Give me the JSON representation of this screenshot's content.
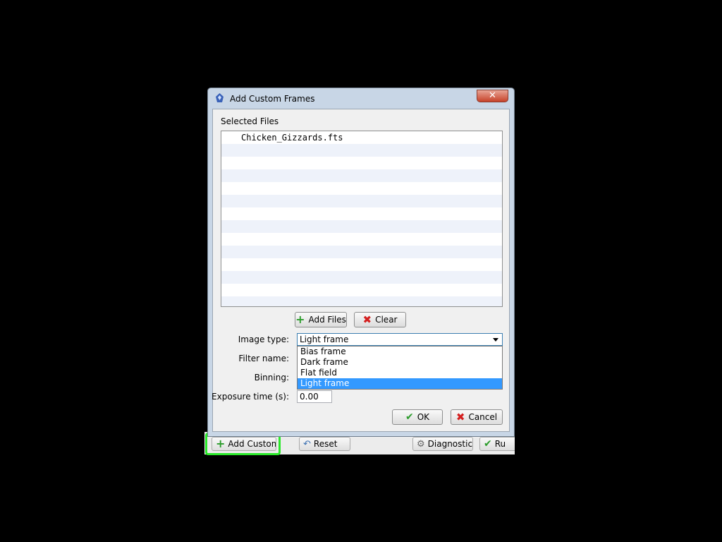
{
  "dialog": {
    "title": "Add Custom Frames",
    "close_label": "✕",
    "selected_files_label": "Selected Files",
    "files": [
      "Chicken_Gizzards.fts",
      "",
      "",
      "",
      "",
      "",
      "",
      "",
      "",
      "",
      "",
      "",
      "",
      ""
    ],
    "add_files_label": "Add Files",
    "clear_label": "Clear",
    "image_type_label": "Image type:",
    "image_type_value": "Light frame",
    "image_type_options": [
      "Bias frame",
      "Dark frame",
      "Flat field",
      "Light frame"
    ],
    "selected_option": "Light frame",
    "filter_name_label": "Filter name:",
    "binning_label": "Binning:",
    "exposure_label": "Exposure time (s):",
    "exposure_value": "0.00",
    "ok_label": "OK",
    "cancel_label": "Cancel"
  },
  "parent_toolbar": {
    "add_custom_label": "Add Custom",
    "reset_label": "Reset",
    "diagnostics_label": "Diagnostics",
    "run_label": "Ru"
  },
  "colors": {
    "highlight": "#2ae82a",
    "selection": "#3399ff",
    "titlebar": "#c8d6e6"
  }
}
